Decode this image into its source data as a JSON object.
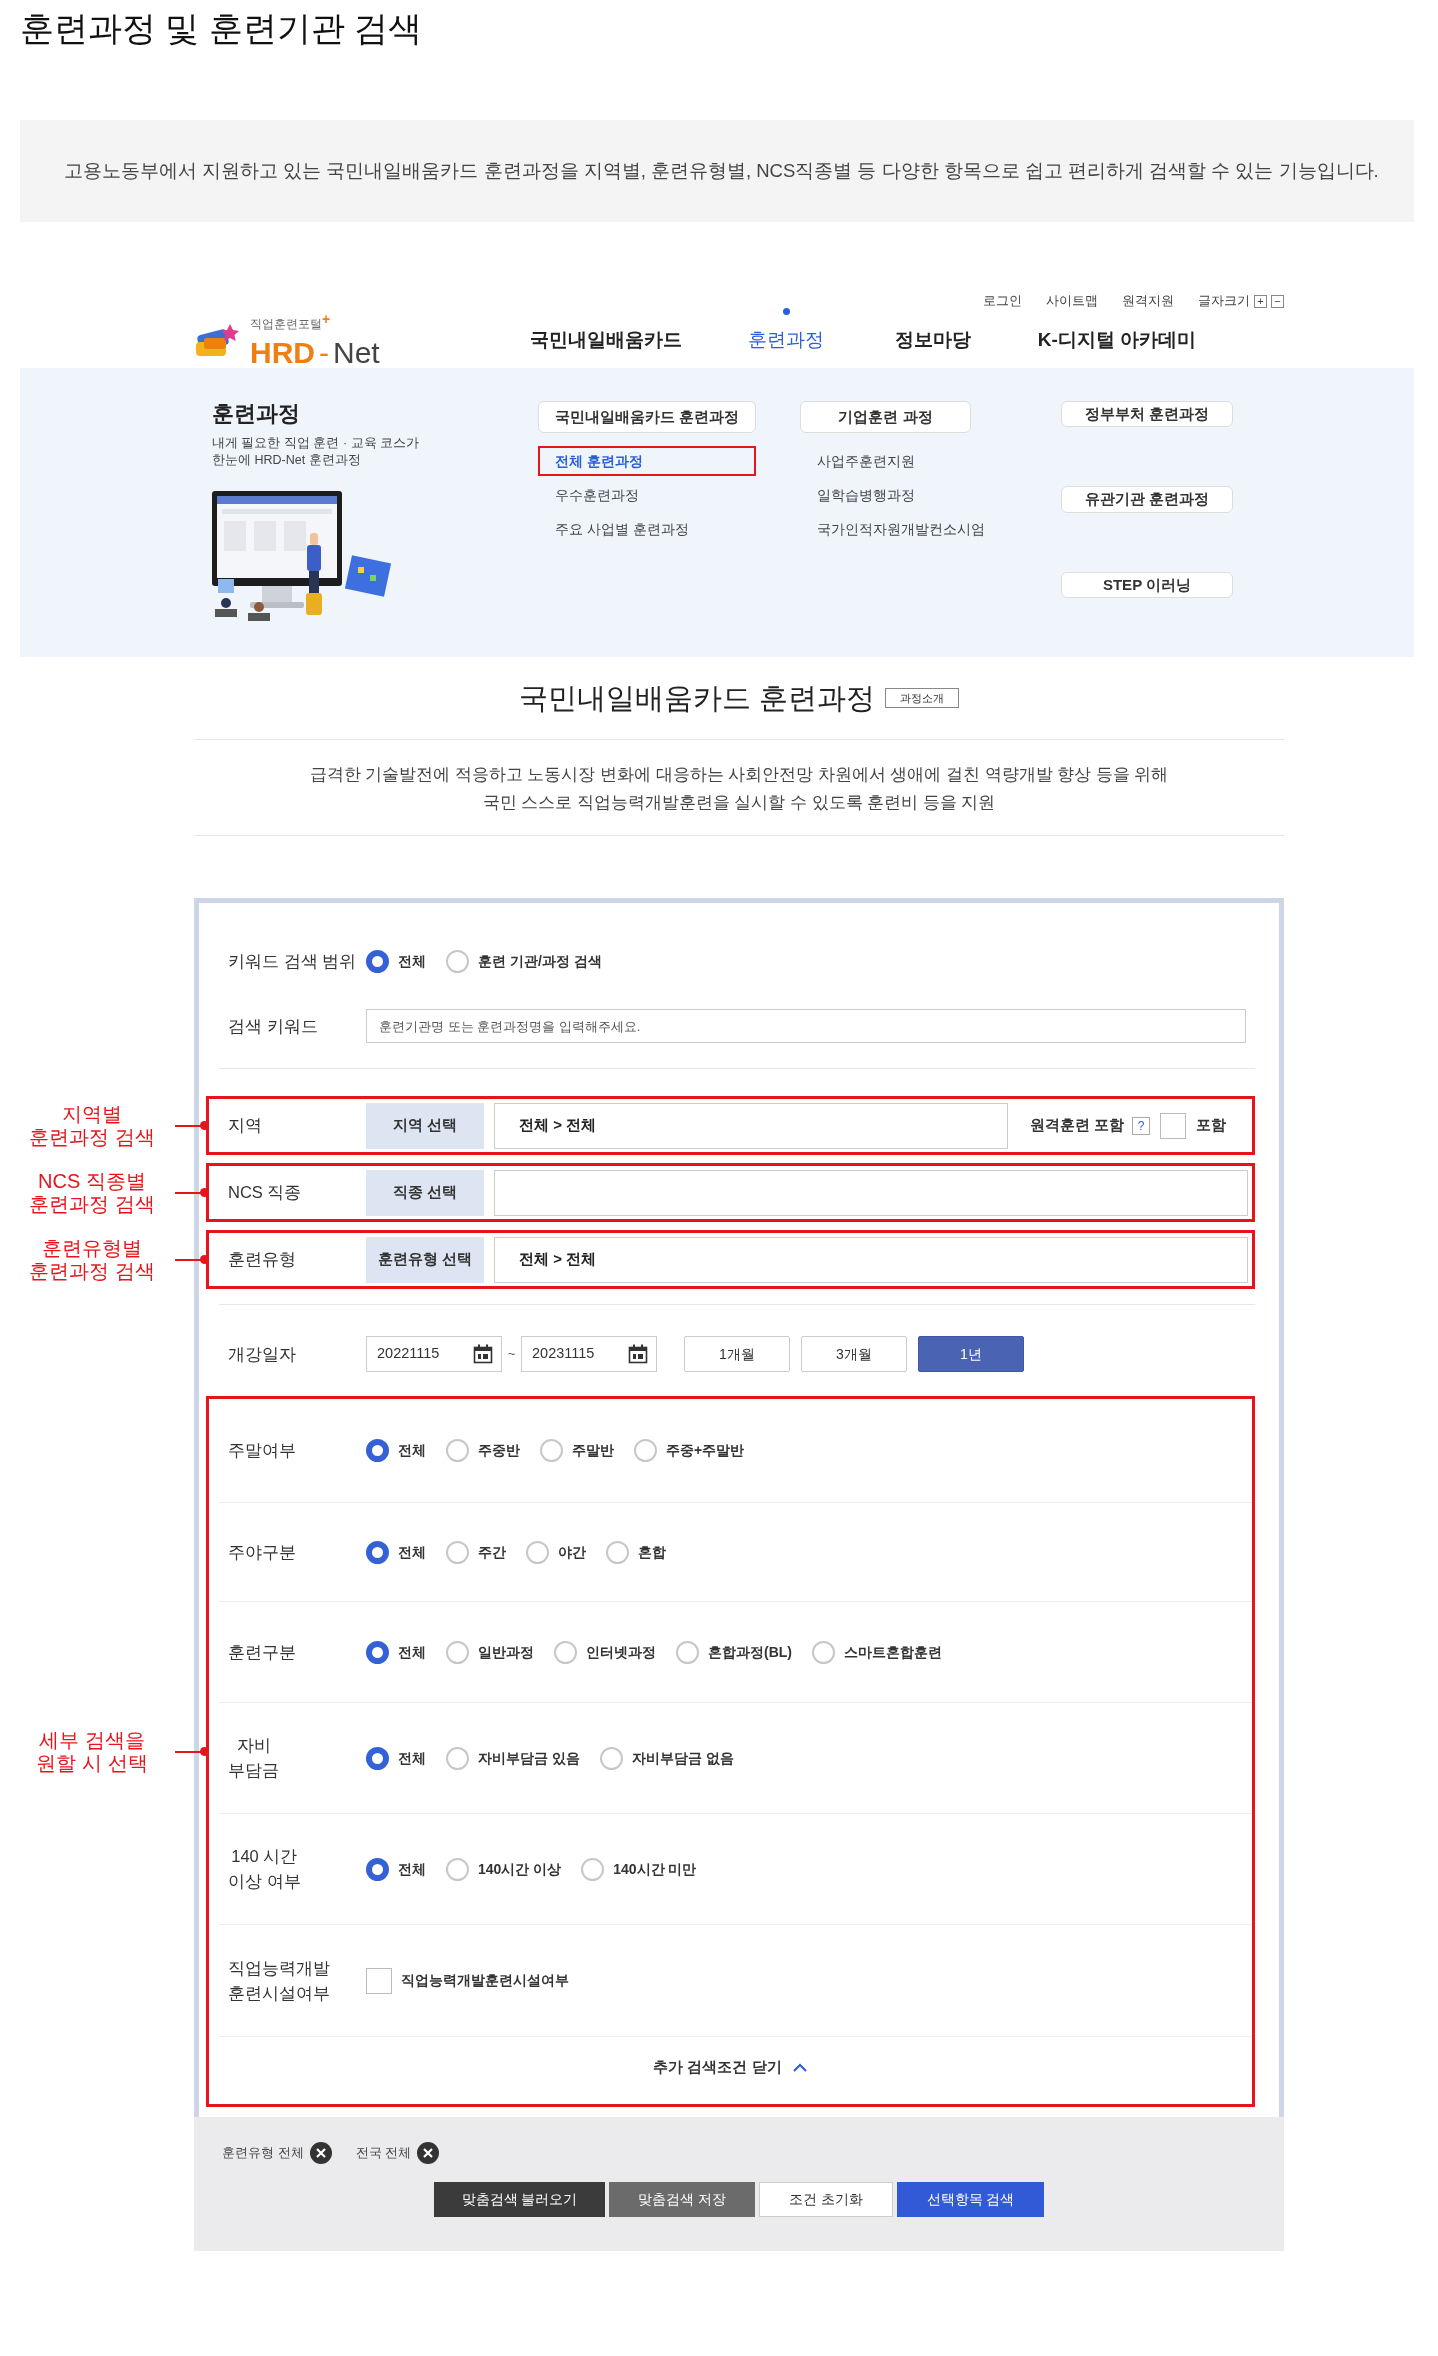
{
  "page_title": "훈련과정 및 훈련기관 검색",
  "intro": "고용노동부에서 지원하고 있는 국민내일배움카드 훈련과정을 지역별, 훈련유형별, NCS직종별 등 다양한 항목으로 쉽고 편리하게 검색할 수 있는 기능입니다.",
  "header": {
    "logo": {
      "tagline": "직업훈련포털$^{+}$",
      "brand": [
        "HRD",
        "-",
        "Net"
      ]
    },
    "utility_links": [
      "로그인",
      "사이트맵",
      "원격지원"
    ],
    "font_size": {
      "label": "글자크기",
      "buttons": [
        "+",
        "−"
      ]
    },
    "nav": [
      {
        "label": "국민내일배움카드",
        "selected": false
      },
      {
        "label": "훈련과정",
        "selected": true
      },
      {
        "label": "정보마당",
        "selected": false
      },
      {
        "label": "K-디지털 아카데미",
        "selected": false
      }
    ]
  },
  "mega_menu": {
    "title": "훈련과정",
    "description_lines": [
      "내게 필요한 직업 훈련 · 교육 코스가",
      "한눈에 HRD-Net 훈련과정"
    ],
    "groups": [
      {
        "heading": "국민내일배움카드 훈련과정",
        "items": [
          {
            "label": "전체 훈련과정",
            "selected": true
          },
          {
            "label": "우수훈련과정",
            "selected": false
          },
          {
            "label": "주요 사업별 훈련과정",
            "selected": false
          }
        ]
      },
      {
        "heading": "기업훈련 과정",
        "items": [
          {
            "label": "사업주훈련지원",
            "selected": false
          },
          {
            "label": "일학습병행과정",
            "selected": false
          },
          {
            "label": "국가인적자원개발컨소시엄",
            "selected": false
          }
        ]
      }
    ],
    "side_buttons": [
      "정부부처 훈련과정",
      "유관기관 훈련과정",
      "STEP 이러닝"
    ]
  },
  "section": {
    "title": "국민내일배움카드 훈련과정",
    "tag": "과정소개",
    "description_lines": [
      "급격한 기술발전에 적응하고 노동시장 변화에 대응하는 사회안전망 차원에서 생애에 걸친 역량개발 향상 등을 위해",
      "국민 스스로 직업능력개발훈련을 실시할 수 있도록 훈련비 등을 지원"
    ]
  },
  "search_form": {
    "keyword_scope": {
      "label": "키워드 검색 범위",
      "options": [
        {
          "label": "전체",
          "selected": true
        },
        {
          "label": "훈련 기관/과정 검색",
          "selected": false
        }
      ]
    },
    "keyword": {
      "label": "검색 키워드",
      "placeholder": "훈련기관명 또는 훈련과정명을 입력해주세요."
    },
    "pickers": [
      {
        "label": "지역",
        "button": "지역 선택",
        "value": "전체 > 전체",
        "annotation_lines": [
          "지역별",
          "훈련과정 검색"
        ],
        "remote": {
          "label": "원격훈련 포함",
          "help": "?",
          "checkbox_label": "포함",
          "checked": false
        }
      },
      {
        "label": "NCS 직종",
        "button": "직종 선택",
        "annotation_lines": [
          "NCS 직종별",
          "훈련과정 검색"
        ]
      },
      {
        "label": "훈련유형",
        "button": "훈련유형 선택",
        "value": "전체 > 전체",
        "annotation_lines": [
          "훈련유형별",
          "훈련과정 검색"
        ]
      }
    ],
    "date": {
      "label": "개강일자",
      "from": "20221115",
      "separator": "~",
      "to": "20231115",
      "periods": [
        {
          "label": "1개월",
          "selected": false
        },
        {
          "label": "3개월",
          "selected": false
        },
        {
          "label": "1년",
          "selected": true
        }
      ]
    },
    "details": {
      "annotation_lines": [
        "세부 검색을",
        "원할 시 선택"
      ],
      "rows": [
        {
          "kind": "radio",
          "label_lines": [
            "주말여부"
          ],
          "options": [
            {
              "label": "전체",
              "selected": true
            },
            {
              "label": "주중반",
              "selected": false
            },
            {
              "label": "주말반",
              "selected": false
            },
            {
              "label": "주중+주말반",
              "selected": false
            }
          ]
        },
        {
          "kind": "radio",
          "label_lines": [
            "주야구분"
          ],
          "options": [
            {
              "label": "전체",
              "selected": true
            },
            {
              "label": "주간",
              "selected": false
            },
            {
              "label": "야간",
              "selected": false
            },
            {
              "label": "혼합",
              "selected": false
            }
          ]
        },
        {
          "kind": "radio",
          "label_lines": [
            "훈련구분"
          ],
          "options": [
            {
              "label": "전체",
              "selected": true
            },
            {
              "label": "일반과정",
              "selected": false
            },
            {
              "label": "인터넷과정",
              "selected": false
            },
            {
              "label": "혼합과정(BL)",
              "selected": false
            },
            {
              "label": "스마트혼합훈련",
              "selected": false
            }
          ]
        },
        {
          "kind": "radio",
          "label_lines": [
            "자비",
            "부담금"
          ],
          "options": [
            {
              "label": "전체",
              "selected": true
            },
            {
              "label": "자비부담금 있음",
              "selected": false
            },
            {
              "label": "자비부담금 없음",
              "selected": false
            }
          ]
        },
        {
          "kind": "radio",
          "label_lines": [
            "140 시간",
            "이상 여부"
          ],
          "options": [
            {
              "label": "전체",
              "selected": true
            },
            {
              "label": "140시간 이상",
              "selected": false
            },
            {
              "label": "140시간 미만",
              "selected": false
            }
          ]
        },
        {
          "kind": "checkbox",
          "label_lines": [
            "직업능력개발",
            "훈련시설여부"
          ],
          "options": [
            {
              "label": "직업능력개발훈련시설여부",
              "checked": false
            }
          ]
        }
      ],
      "toggle": "추가 검색조건 닫기"
    }
  },
  "summary": {
    "chips": [
      "훈련유형 전체",
      "전국 전체"
    ],
    "buttons": [
      {
        "label": "맞춤검색 불러오기",
        "kind": "dark"
      },
      {
        "label": "맞춤검색 저장",
        "kind": "gray"
      },
      {
        "label": "조건 초기화",
        "kind": "outline"
      },
      {
        "label": "선택항목 검색",
        "kind": "primary"
      }
    ]
  }
}
